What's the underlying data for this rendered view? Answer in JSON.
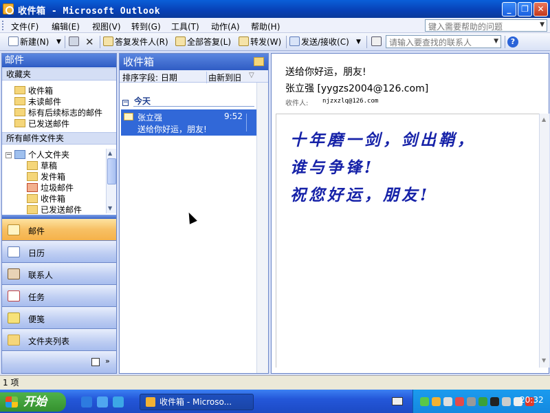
{
  "window": {
    "title": "收件箱 - Microsoft Outlook",
    "min_glyph": "_",
    "max_glyph": "❐",
    "close_glyph": "✕"
  },
  "menubar": {
    "items": [
      "文件(F)",
      "编辑(E)",
      "视图(V)",
      "转到(G)",
      "工具(T)",
      "动作(A)",
      "帮助(H)"
    ],
    "help_search_placeholder": "键入需要帮助的问题"
  },
  "toolbar": {
    "new_label": "新建(N)",
    "reply_label": "答复发件人(R)",
    "reply_all_label": "全部答复(L)",
    "forward_label": "转发(W)",
    "send_receive_label": "发送/接收(C)",
    "contact_search_placeholder": "请输入要查找的联系人",
    "help_icon_glyph": "?"
  },
  "nav": {
    "header": "邮件",
    "favorites_title": "收藏夹",
    "favorites": [
      "收件箱",
      "未读邮件",
      "标有后续标志的邮件",
      "已发送邮件"
    ],
    "all_folders_title": "所有邮件文件夹",
    "root_folder": "个人文件夹",
    "folders": [
      "草稿",
      "发件箱",
      "垃圾邮件",
      "收件箱",
      "已发送邮件"
    ],
    "buttons": [
      "邮件",
      "日历",
      "联系人",
      "任务",
      "便笺",
      "文件夹列表"
    ],
    "active_button": "邮件"
  },
  "list": {
    "header": "收件箱",
    "sort_label": "排序字段: 日期",
    "sort_order": "由新到旧",
    "group_label": "今天",
    "messages": [
      {
        "from": "张立强",
        "time": "9:52",
        "subject": "送给你好运，朋友!"
      }
    ]
  },
  "reading": {
    "subject": "送给你好运，朋友!",
    "from": "张立强 [yygzs2004@126.com]",
    "to_label": "收件人:",
    "to": "njzxzlq@126.com",
    "body_lines": [
      "十年磨一剑，剑出鞘，",
      "谁与争锋!",
      "祝您好运，朋友!"
    ],
    "body_color": "#1622a8"
  },
  "status": {
    "text": "1 项"
  },
  "taskbar": {
    "start_label": "开始",
    "task_label": "收件箱 - Microso...",
    "clock": "20:32"
  },
  "colors": {
    "accent_blue": "#3168d8",
    "active_nav": "#f7c064",
    "titlebar": "#0842b8"
  }
}
